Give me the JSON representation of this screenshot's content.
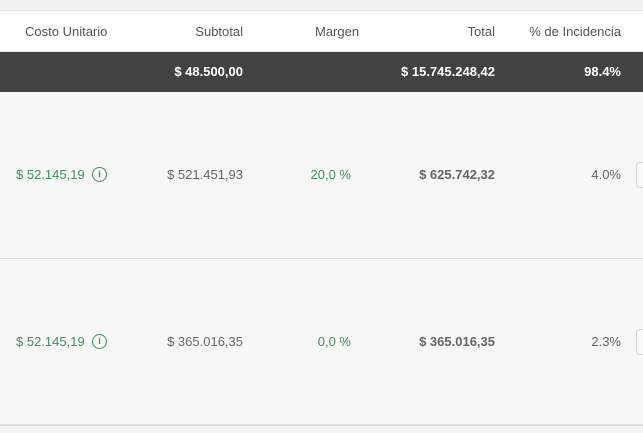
{
  "header": {
    "costo_unitario": "Costo Unitario",
    "subtotal": "Subtotal",
    "margen": "Margen",
    "total": "Total",
    "incidencia": "% de Incidencia"
  },
  "totals": {
    "subtotal": "$ 48.500,00",
    "total": "$ 15.745.248,42",
    "incidencia": "98.4%"
  },
  "rows": [
    {
      "costo_unitario": "$ 52.145,19",
      "subtotal": "$ 521.451,93",
      "margen": "20,0 %",
      "total": "$ 625.742,32",
      "incidencia": "4.0%"
    },
    {
      "costo_unitario": "$ 52.145,19",
      "subtotal": "$ 365.016,35",
      "margen": "0,0 %",
      "total": "$ 365.016,35",
      "incidencia": "2.3%"
    }
  ],
  "icons": {
    "info": "info-circle-icon"
  },
  "colors": {
    "accent_green": "#3f8f5b",
    "totals_bg": "#424242",
    "text_gray": "#666666"
  }
}
